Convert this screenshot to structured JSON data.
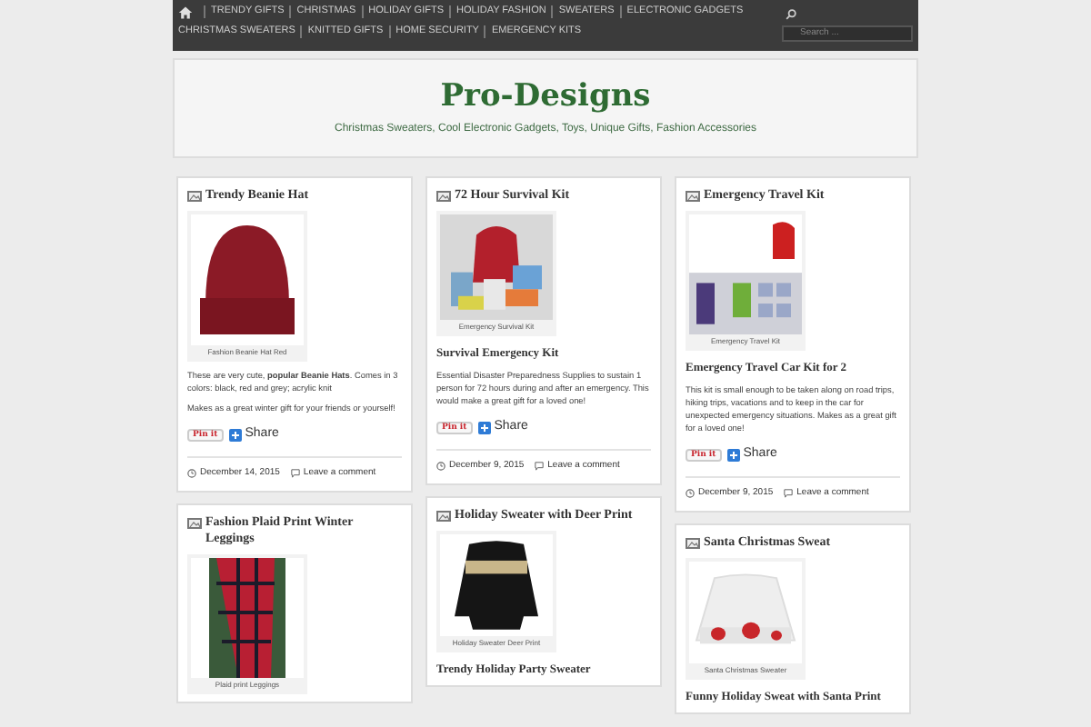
{
  "nav": {
    "rows": [
      [
        "TRENDY GIFTS",
        "CHRISTMAS",
        "HOLIDAY GIFTS",
        "HOLIDAY FASHION",
        "SWEATERS",
        "ELECTRONIC GADGETS"
      ],
      [
        "CHRISTMAS SWEATERS",
        "KNITTED GIFTS",
        "HOME SECURITY",
        "EMERGENCY KITS"
      ]
    ],
    "search": {
      "placeholder": "Search ..."
    }
  },
  "header": {
    "title": "Pro-Designs",
    "tagline": "Christmas Sweaters, Cool Electronic Gadgets, Toys, Unique Gifts, Fashion Accessories"
  },
  "columns": [
    [
      {
        "title": "Trendy Beanie Hat",
        "image": {
          "kind": "hat",
          "caption": "Fashion Beanie Hat Red"
        },
        "paragraphs": [
          "These are very cute, **popular Beanie Hats**. Comes in 3 colors: black, red and grey; acrylic knit",
          "Makes as a great winter gift for your friends or yourself!"
        ],
        "pin": "Pin it",
        "share": "Share",
        "date": "December 14, 2015",
        "comment": "Leave a comment"
      },
      {
        "title": "Fashion Plaid Print Winter Leggings",
        "image": {
          "kind": "leggings",
          "caption": "Plaid print Leggings"
        }
      }
    ],
    [
      {
        "title": "72 Hour Survival Kit",
        "image": {
          "kind": "kit",
          "caption": "Emergency Survival Kit"
        },
        "heading": "Survival Emergency Kit",
        "paragraphs": [
          "Essential Disaster Preparedness Supplies to sustain 1 person for 72 hours during and after an emergency. This would make a great gift for a loved one!"
        ],
        "pin": "Pin it",
        "share": "Share",
        "date": "December 9, 2015",
        "comment": "Leave a comment"
      },
      {
        "title": "Holiday Sweater with Deer Print",
        "image": {
          "kind": "dark-sweater",
          "caption": "Holiday Sweater Deer Print"
        },
        "heading": "Trendy Holiday Party Sweater"
      }
    ],
    [
      {
        "title": "Emergency Travel Kit",
        "image": {
          "kind": "travel-kit",
          "caption": "Emergency Travel Kit"
        },
        "heading": "Emergency Travel Car Kit for 2",
        "paragraphs": [
          "This kit is small enough to be taken along on road trips, hiking trips, vacations and to keep in the car for unexpected emergency situations. Makes as a great gift for a loved one!"
        ],
        "pin": "Pin it",
        "share": "Share",
        "date": "December 9, 2015",
        "comment": "Leave a comment"
      },
      {
        "title": "Santa Christmas Sweat",
        "image": {
          "kind": "white-sweater",
          "caption": "Santa Christmas Sweater"
        },
        "heading": "Funny Holiday Sweat with Santa Print"
      }
    ]
  ]
}
